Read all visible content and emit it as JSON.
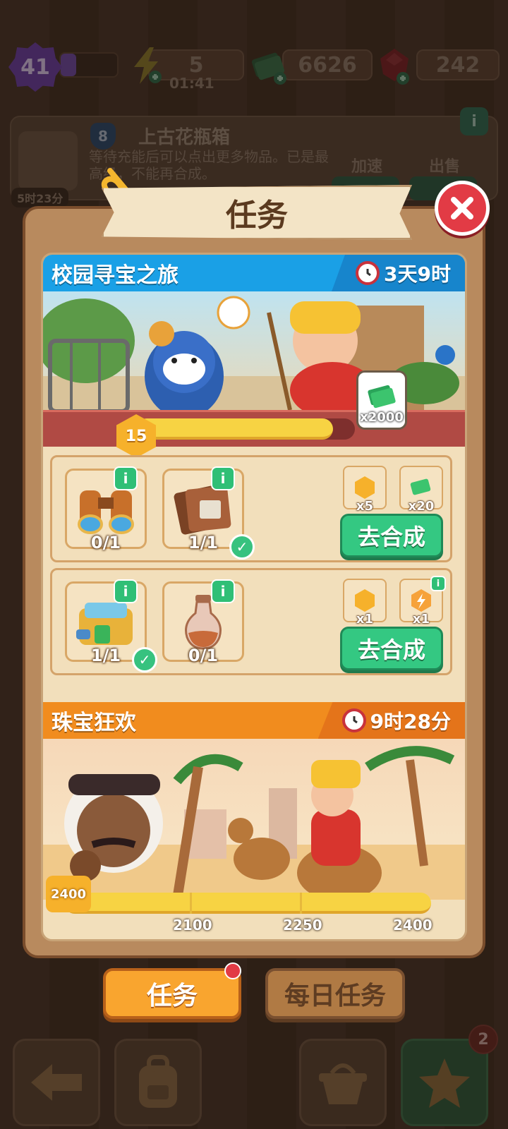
{
  "topbar": {
    "level": "41",
    "energy": "5",
    "energy_timer": "01:41",
    "cash": "6626",
    "gems": "242"
  },
  "info_card": {
    "tier": "8",
    "name": "上古花瓶箱",
    "desc": "等待充能后可以点出更多物品。已是最高级，不能再合成。",
    "timer": "5时23分",
    "speed_label": "加速",
    "sell_label": "出售"
  },
  "modal": {
    "title": "任务",
    "tasks": [
      {
        "title": "校园寻宝之旅",
        "time_left": "3天9时",
        "level": "15",
        "progress": 0.9,
        "reward_amount": "x2000",
        "rows": [
          {
            "items": [
              {
                "name": "binoculars",
                "count": "0/1",
                "done": false
              },
              {
                "name": "leather-folder",
                "count": "1/1",
                "done": true
              }
            ],
            "rewards": [
              {
                "icon": "xp-hex",
                "amount": "x5"
              },
              {
                "icon": "cash",
                "amount": "x20"
              }
            ],
            "button": "去合成"
          },
          {
            "items": [
              {
                "name": "cooler-box",
                "count": "1/1",
                "done": true
              },
              {
                "name": "vase",
                "count": "0/1",
                "done": false
              }
            ],
            "rewards": [
              {
                "icon": "xp-hex",
                "amount": "x1"
              },
              {
                "icon": "energy-box",
                "amount": "x1"
              }
            ],
            "button": "去合成"
          }
        ]
      },
      {
        "title": "珠宝狂欢",
        "time_left": "9时28分",
        "current": "2400",
        "milestones": [
          "2100",
          "2250",
          "2400"
        ]
      }
    ]
  },
  "tabs": {
    "tasks": "任务",
    "daily": "每日任务"
  },
  "nav": {
    "badge": "2"
  },
  "colors": {
    "blue_header": "#1aa0e6",
    "orange_header": "#f18c1e",
    "merge_green": "#34c882",
    "close_red": "#e23b45"
  }
}
